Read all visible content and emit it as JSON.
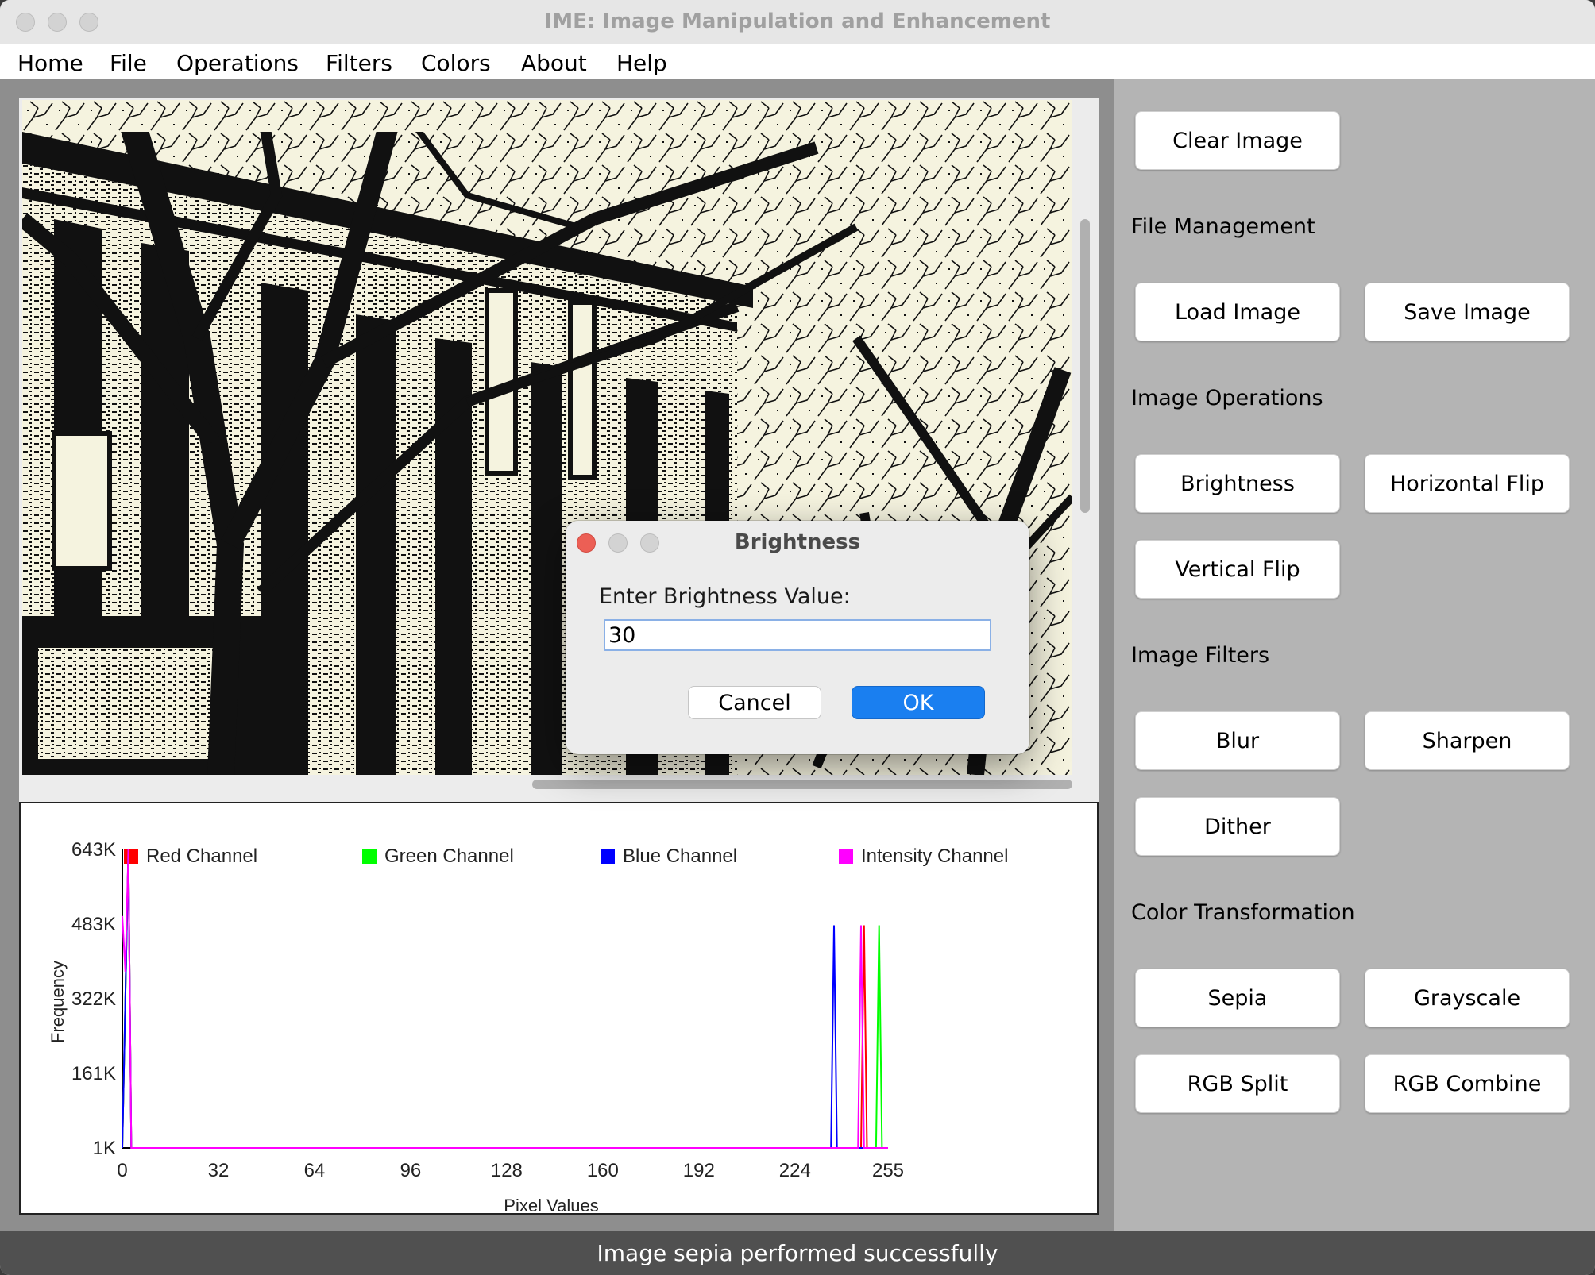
{
  "window": {
    "title": "IME: Image Manipulation and Enhancement"
  },
  "menu": [
    "Home",
    "File",
    "Operations",
    "Filters",
    "Colors",
    "About",
    "Help"
  ],
  "sidebar": {
    "clear_label": "Clear Image",
    "sections": {
      "file": "File Management",
      "operations": "Image Operations",
      "filters": "Image Filters",
      "colors": "Color Transformation"
    },
    "buttons": {
      "load": "Load Image",
      "save": "Save Image",
      "brightness": "Brightness",
      "hflip": "Horizontal Flip",
      "vflip": "Vertical Flip",
      "blur": "Blur",
      "sharpen": "Sharpen",
      "dither": "Dither",
      "sepia": "Sepia",
      "grayscale": "Grayscale",
      "rgb_split": "RGB Split",
      "rgb_combine": "RGB Combine"
    }
  },
  "dialog": {
    "title": "Brightness",
    "prompt": "Enter Brightness Value:",
    "value": "30",
    "cancel_label": "Cancel",
    "ok_label": "OK"
  },
  "status": "Image sepia performed successfully",
  "colors": {
    "red": "#ff0000",
    "green": "#00ff00",
    "blue": "#0000ff",
    "intensity": "#ff00ff",
    "ok_button": "#1a7ff0",
    "image_background": "#f5f3df"
  },
  "chart_data": {
    "type": "line",
    "title": "",
    "xlabel": "Pixel Values",
    "ylabel": "Frequency",
    "x_ticks": [
      "0",
      "32",
      "64",
      "96",
      "128",
      "160",
      "192",
      "224",
      "255"
    ],
    "y_ticks": [
      "1K",
      "161K",
      "322K",
      "483K",
      "643K"
    ],
    "xlim": [
      0,
      255
    ],
    "ylim": [
      1000,
      643000
    ],
    "legend_position": "top",
    "series": [
      {
        "name": "Red Channel",
        "color": "#ff0000",
        "points": [
          [
            0,
            1000
          ],
          [
            2,
            643000
          ],
          [
            3,
            1000
          ],
          [
            246,
            1000
          ],
          [
            247,
            480000
          ],
          [
            248,
            1000
          ],
          [
            255,
            1000
          ]
        ]
      },
      {
        "name": "Green Channel",
        "color": "#00ff00",
        "points": [
          [
            0,
            1000
          ],
          [
            2,
            643000
          ],
          [
            3,
            1000
          ],
          [
            251,
            1000
          ],
          [
            252,
            480000
          ],
          [
            253,
            1000
          ],
          [
            255,
            1000
          ]
        ]
      },
      {
        "name": "Blue Channel",
        "color": "#0000ff",
        "points": [
          [
            0,
            1000
          ],
          [
            2,
            643000
          ],
          [
            3,
            1000
          ],
          [
            236,
            1000
          ],
          [
            237,
            480000
          ],
          [
            238,
            1000
          ],
          [
            255,
            1000
          ]
        ]
      },
      {
        "name": "Intensity Channel",
        "color": "#ff00ff",
        "points": [
          [
            0,
            500000
          ],
          [
            1,
            380000
          ],
          [
            2,
            643000
          ],
          [
            3,
            1000
          ],
          [
            245,
            1000
          ],
          [
            246,
            480000
          ],
          [
            247,
            1000
          ],
          [
            255,
            1000
          ]
        ]
      }
    ]
  }
}
